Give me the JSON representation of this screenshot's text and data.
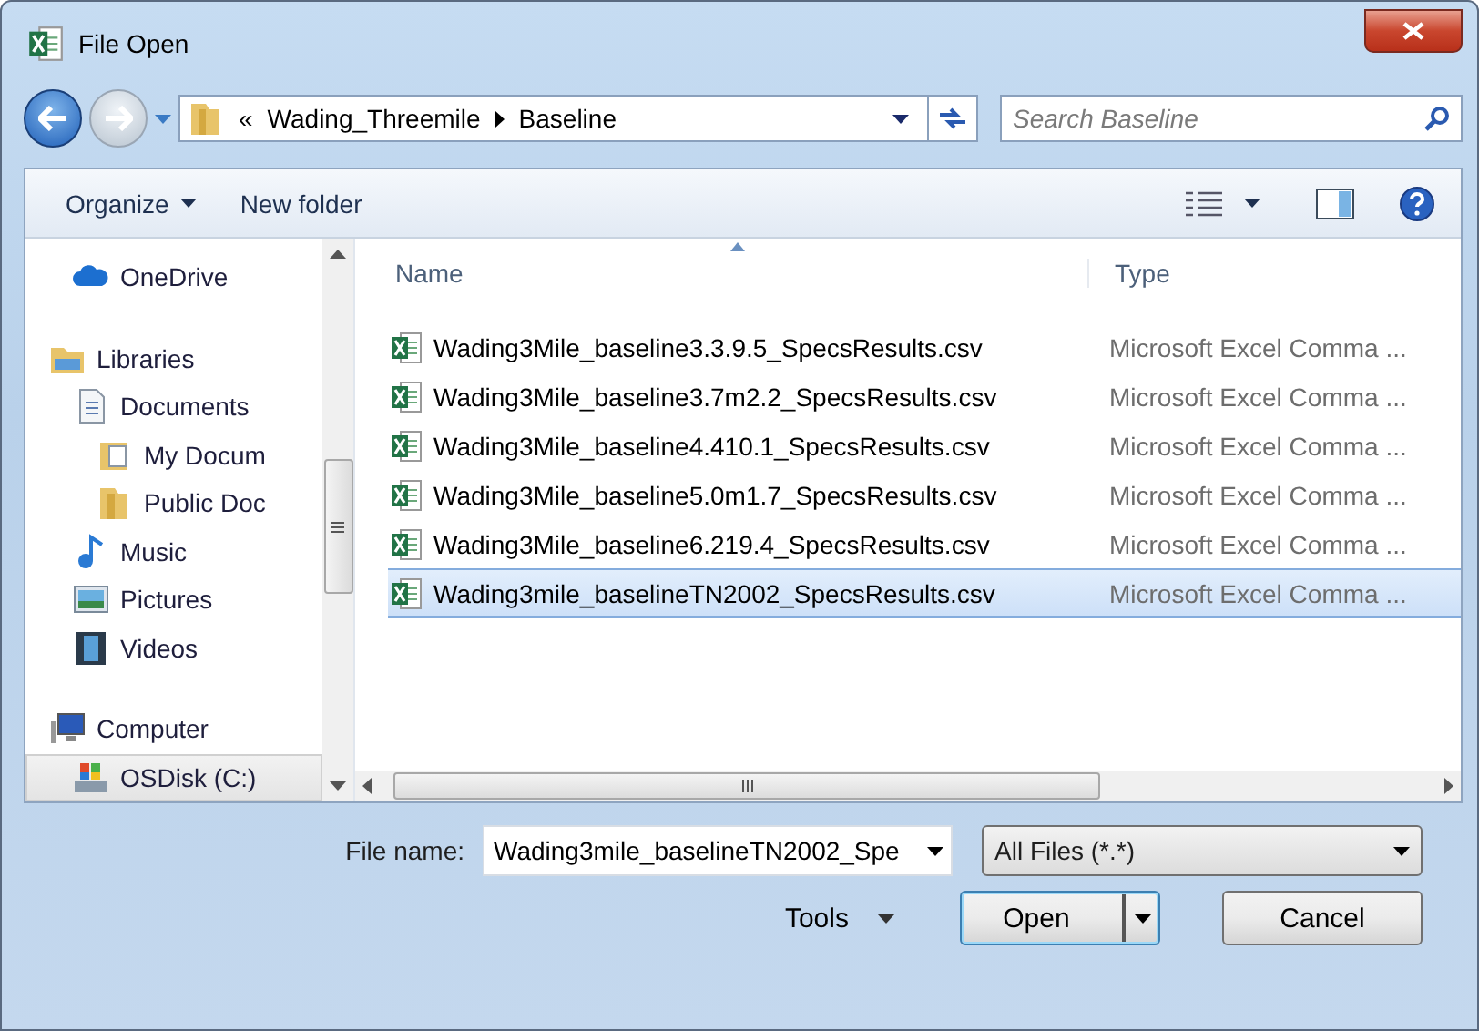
{
  "window": {
    "title": "File Open"
  },
  "address": {
    "overflow": "«",
    "crumbs": [
      "Wading_Threemile",
      "Baseline"
    ]
  },
  "search": {
    "placeholder": "Search Baseline"
  },
  "toolbar": {
    "organize": "Organize",
    "new_folder": "New folder"
  },
  "sidebar": {
    "items": [
      {
        "label": "OneDrive",
        "kind": "cloud",
        "selected": false
      },
      {
        "label": "Libraries",
        "kind": "library",
        "selected": false,
        "children": [
          {
            "label": "Documents",
            "kind": "document",
            "selected": false,
            "children": [
              {
                "label": "My Docum",
                "kind": "docfolder",
                "selected": false
              },
              {
                "label": "Public Doc",
                "kind": "folder",
                "selected": false
              }
            ]
          },
          {
            "label": "Music",
            "kind": "music",
            "selected": false
          },
          {
            "label": "Pictures",
            "kind": "pictures",
            "selected": false
          },
          {
            "label": "Videos",
            "kind": "videos",
            "selected": false
          }
        ]
      },
      {
        "label": "Computer",
        "kind": "computer",
        "selected": false,
        "children": [
          {
            "label": "OSDisk (C:)",
            "kind": "disk",
            "selected": true
          }
        ]
      }
    ]
  },
  "file_list": {
    "columns": [
      "Name",
      "Type"
    ],
    "rows": [
      {
        "name": "Wading3Mile_baseline3.3.9.5_SpecsResults.csv",
        "type": "Microsoft Excel Comma ...",
        "selected": false
      },
      {
        "name": "Wading3Mile_baseline3.7m2.2_SpecsResults.csv",
        "type": "Microsoft Excel Comma ...",
        "selected": false
      },
      {
        "name": "Wading3Mile_baseline4.410.1_SpecsResults.csv",
        "type": "Microsoft Excel Comma ...",
        "selected": false
      },
      {
        "name": "Wading3Mile_baseline5.0m1.7_SpecsResults.csv",
        "type": "Microsoft Excel Comma ...",
        "selected": false
      },
      {
        "name": "Wading3Mile_baseline6.219.4_SpecsResults.csv",
        "type": "Microsoft Excel Comma ...",
        "selected": false
      },
      {
        "name": "Wading3mile_baselineTN2002_SpecsResults.csv",
        "type": "Microsoft Excel Comma ...",
        "selected": true
      }
    ]
  },
  "file_name": {
    "label": "File name:",
    "value": "Wading3mile_baselineTN2002_Spe"
  },
  "file_type": {
    "value": "All Files (*.*)"
  },
  "buttons": {
    "tools": "Tools",
    "open": "Open",
    "cancel": "Cancel"
  }
}
